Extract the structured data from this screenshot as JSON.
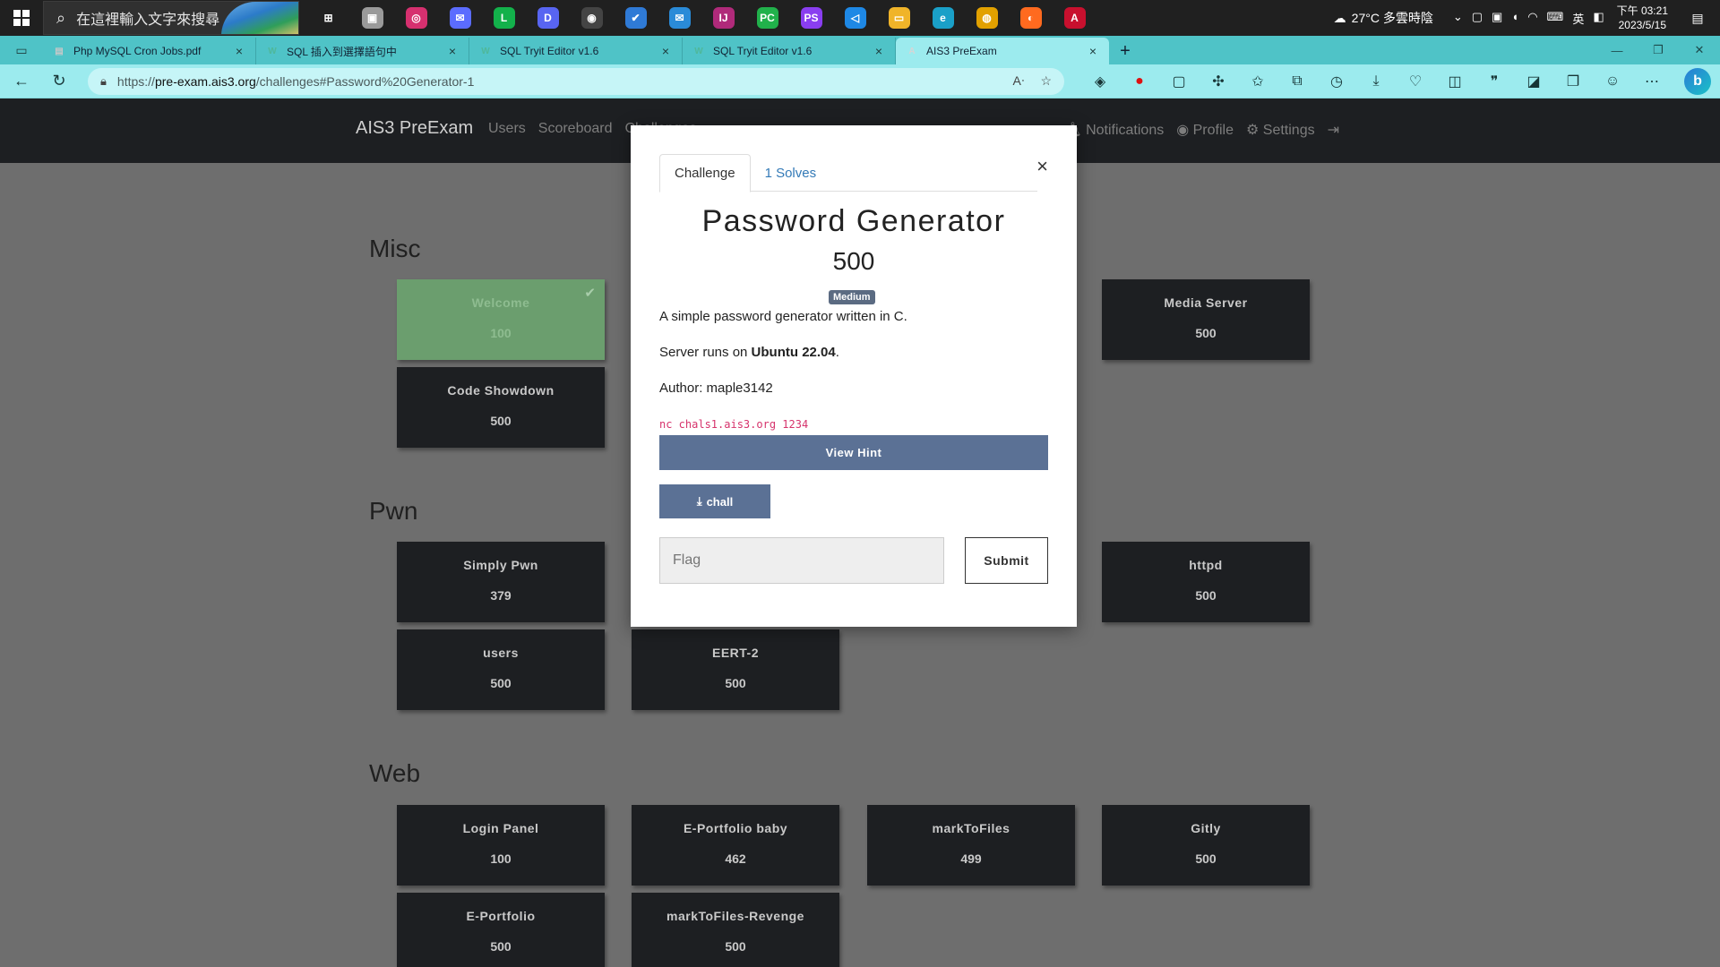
{
  "taskbar": {
    "search_placeholder": "在這裡輸入文字來搜尋",
    "weather": "27°C  多雲時陰",
    "ime": "英",
    "clock_time": "下午 03:21",
    "clock_date": "2023/5/15",
    "apps": [
      {
        "name": "task-view-icon",
        "glyph": "⊞",
        "color": "#202020"
      },
      {
        "name": "photo-app-icon",
        "glyph": "▣",
        "color": "#9a9a9a"
      },
      {
        "name": "instagram-icon",
        "glyph": "◎",
        "color": "#d6306f"
      },
      {
        "name": "messenger-icon",
        "glyph": "✉",
        "color": "#5b6cff"
      },
      {
        "name": "line-icon",
        "glyph": "L",
        "color": "#13b14b"
      },
      {
        "name": "discord-icon",
        "glyph": "D",
        "color": "#5865f2"
      },
      {
        "name": "media-player-icon",
        "glyph": "◉",
        "color": "#444"
      },
      {
        "name": "todo-icon",
        "glyph": "✔",
        "color": "#2f7ad6"
      },
      {
        "name": "mail-icon",
        "glyph": "✉",
        "color": "#2a8bd8"
      },
      {
        "name": "intellij-icon",
        "glyph": "IJ",
        "color": "#b02a7a"
      },
      {
        "name": "pycharm-icon",
        "glyph": "PC",
        "color": "#21b14b"
      },
      {
        "name": "phpstorm-icon",
        "glyph": "PS",
        "color": "#8a3ef0"
      },
      {
        "name": "vscode-icon",
        "glyph": "◁",
        "color": "#1e88e5"
      },
      {
        "name": "file-explorer-icon",
        "glyph": "▭",
        "color": "#f0b429"
      },
      {
        "name": "edge-icon",
        "glyph": "e",
        "color": "#1aa0c8"
      },
      {
        "name": "chrome-icon",
        "glyph": "◍",
        "color": "#e2a100"
      },
      {
        "name": "firefox-icon",
        "glyph": "◐",
        "color": "#ff6a1f"
      },
      {
        "name": "adobe-icon",
        "glyph": "A",
        "color": "#c8102e"
      }
    ]
  },
  "browser": {
    "tabs": [
      {
        "title": "Php MySQL Cron Jobs.pdf",
        "favicon": "▤",
        "fav_color": "#c8c8c8",
        "active": false
      },
      {
        "title": "SQL 插入到選擇語句中",
        "favicon": "W",
        "fav_color": "#4fb89b",
        "active": false
      },
      {
        "title": "SQL Tryit Editor v1.6",
        "favicon": "W",
        "fav_color": "#4fb89b",
        "active": false
      },
      {
        "title": "SQL Tryit Editor v1.6",
        "favicon": "W",
        "fav_color": "#4fb89b",
        "active": false
      },
      {
        "title": "AIS3 PreExam",
        "favicon": "A",
        "fav_color": "#d6d6d6",
        "active": true
      }
    ],
    "url_scheme": "https://",
    "url_host": "pre-exam.ais3.org",
    "url_path": "/challenges#Password%20Generator-1"
  },
  "site": {
    "brand": "AIS3 PreExam",
    "nav_links": [
      "Users",
      "Scoreboard",
      "Challenges"
    ],
    "right_links": [
      "Notifications",
      "Profile",
      "Settings"
    ]
  },
  "sections": [
    {
      "title": "Misc"
    },
    {
      "title": "Pwn"
    },
    {
      "title": "Web"
    }
  ],
  "cards": {
    "welcome": {
      "name": "Welcome",
      "value": "100"
    },
    "media_server": {
      "name": "Media Server",
      "value": "500"
    },
    "code_showdown": {
      "name": "Code Showdown",
      "value": "500"
    },
    "simply_pwn": {
      "name": "Simply Pwn",
      "value": "379"
    },
    "httpd": {
      "name": "httpd",
      "value": "500"
    },
    "users": {
      "name": "users",
      "value": "500"
    },
    "eert2": {
      "name": "EERT-2",
      "value": "500"
    },
    "login_panel": {
      "name": "Login Panel",
      "value": "100"
    },
    "eportfolio_baby": {
      "name": "E-Portfolio baby",
      "value": "462"
    },
    "marktofiles": {
      "name": "markToFiles",
      "value": "499"
    },
    "gitly": {
      "name": "Gitly",
      "value": "500"
    },
    "eportfolio": {
      "name": "E-Portfolio",
      "value": "500"
    },
    "marktofiles_revenge": {
      "name": "markToFiles-Revenge",
      "value": "500"
    }
  },
  "modal": {
    "tab_challenge": "Challenge",
    "tab_solves": "1 Solves",
    "close": "×",
    "title": "Password Generator",
    "value": "500",
    "badge": "Medium",
    "desc_line1": "A simple password generator written in C.",
    "desc_line2_prefix": "Server runs on ",
    "desc_line2_bold": "Ubuntu 22.04",
    "desc_line2_suffix": ".",
    "author": "Author: maple3142",
    "connection": "nc chals1.ais3.org 1234",
    "hint_label": "View Hint",
    "file_label": "chall",
    "flag_placeholder": "Flag",
    "submit_label": "Submit"
  }
}
